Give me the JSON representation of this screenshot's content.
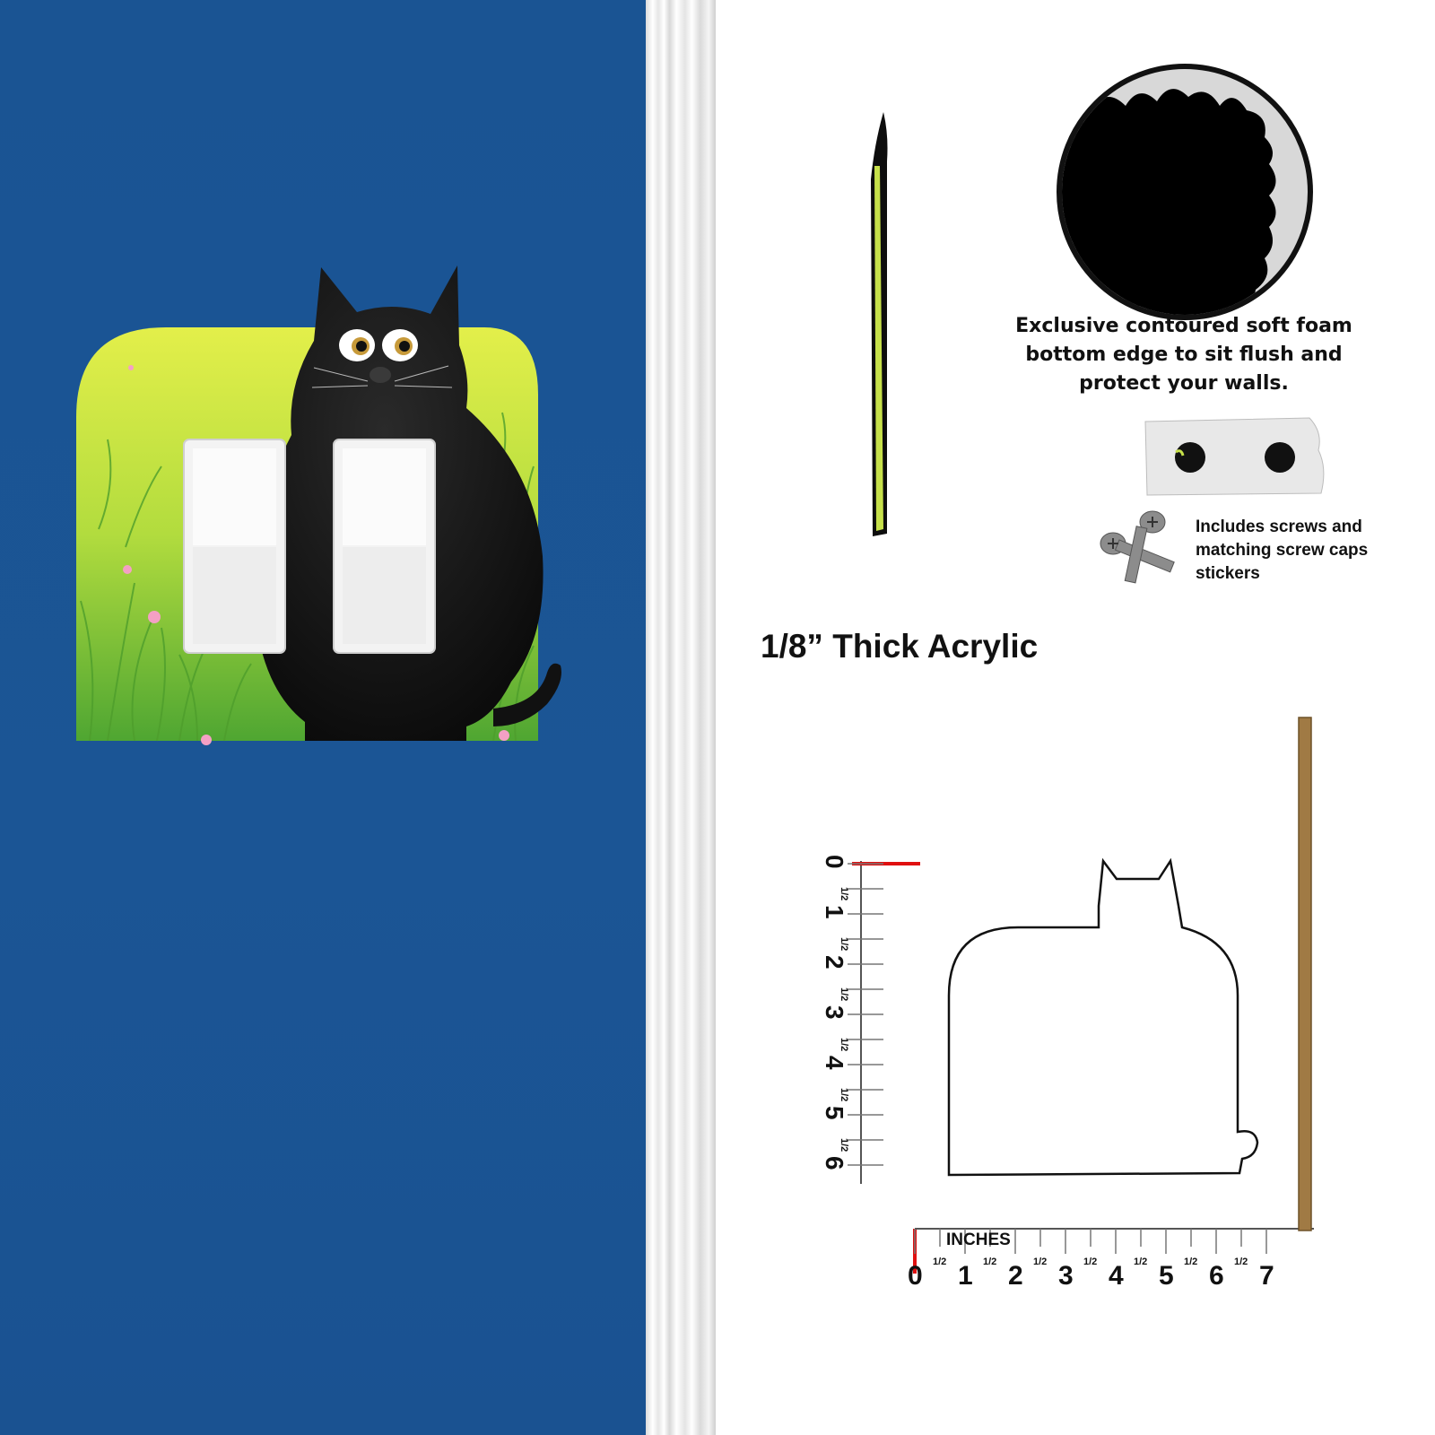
{
  "foam_feature": {
    "caption": "Exclusive contoured soft foam bottom edge to sit flush and protect your walls."
  },
  "hardware_feature": {
    "caption": "Includes screws and matching screw caps stickers"
  },
  "material": {
    "label": "1/8” Thick Acrylic"
  },
  "ruler": {
    "unit_label": "INCHES",
    "horizontal_numbers": [
      "0",
      "1",
      "2",
      "3",
      "4",
      "5",
      "6",
      "7"
    ],
    "vertical_numbers": [
      "0",
      "1",
      "2",
      "3",
      "4",
      "5",
      "6"
    ],
    "half_label": "1/2"
  },
  "colors": {
    "wall": "#1b5595",
    "grass": "#8fc83a",
    "ruler_zero": "#e01010",
    "stick": "#a07a44"
  },
  "icons": [
    "black-cat-illustration",
    "rocker-switch",
    "foam-edge-closeup",
    "screw-caps-sticker",
    "screws"
  ]
}
